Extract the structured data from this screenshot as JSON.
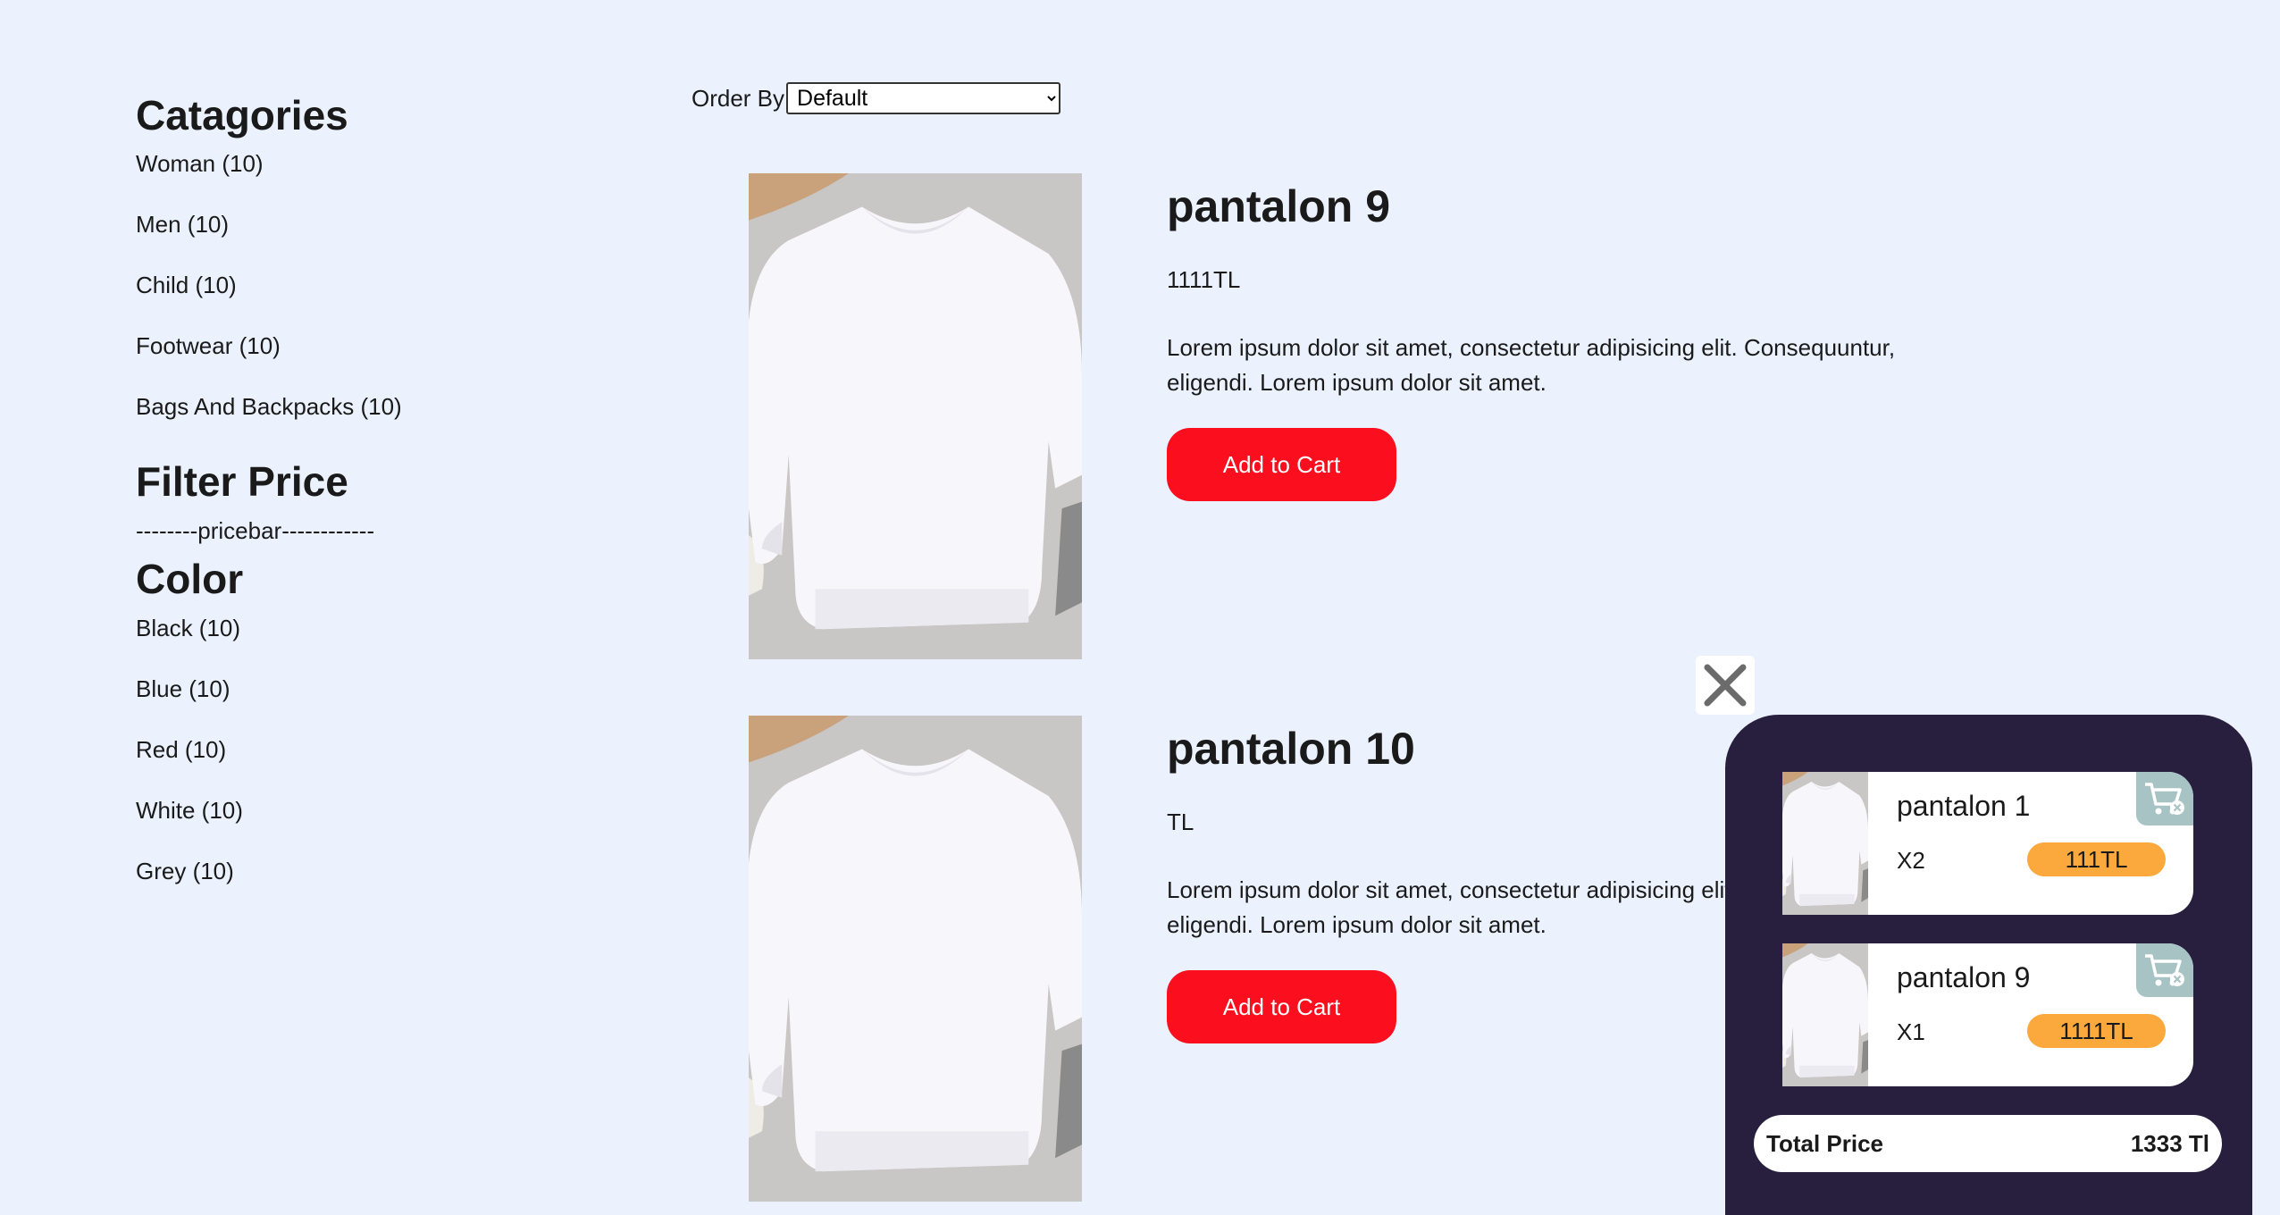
{
  "sidebar": {
    "categories_heading": "Catagories",
    "categories": [
      {
        "label": "Woman (10)"
      },
      {
        "label": "Men (10)"
      },
      {
        "label": "Child (10)"
      },
      {
        "label": "Footwear (10)"
      },
      {
        "label": "Bags And Backpacks (10)"
      }
    ],
    "filter_heading": "Filter Price",
    "pricebar": "--------pricebar------------",
    "color_heading": "Color",
    "colors": [
      {
        "label": "Black (10)"
      },
      {
        "label": "Blue (10)"
      },
      {
        "label": "Red (10)"
      },
      {
        "label": "White (10)"
      },
      {
        "label": "Grey (10)"
      }
    ]
  },
  "order": {
    "label": "Order By",
    "selected": "Default"
  },
  "products": [
    {
      "title": "pantalon 9",
      "price": "1111TL",
      "description": "Lorem ipsum dolor sit amet, consectetur adipisicing elit. Consequuntur, eligendi. Lorem ipsum dolor sit amet.",
      "button_label": "Add to Cart"
    },
    {
      "title": "pantalon 10",
      "price": "TL",
      "description": "Lorem ipsum dolor sit amet, consectetur adipisicing elit. Consequuntur, eligendi. Lorem ipsum dolor sit amet.",
      "button_label": "Add to Cart"
    }
  ],
  "cart": {
    "items": [
      {
        "name": "pantalon 1",
        "qty": "X2",
        "price": "111TL"
      },
      {
        "name": "pantalon 9",
        "qty": "X1",
        "price": "1111TL"
      }
    ],
    "total_label": "Total Price",
    "total_value": "1333 Tl"
  },
  "icons": {
    "close": "close-icon",
    "cart_remove": "cart-remove-icon"
  },
  "colors": {
    "page_bg": "#ebf2fe",
    "button_red": "#fb0f1e",
    "cart_bg": "#281e3d",
    "price_pill": "#fba83c",
    "remove_bg": "#a7c3c4"
  }
}
